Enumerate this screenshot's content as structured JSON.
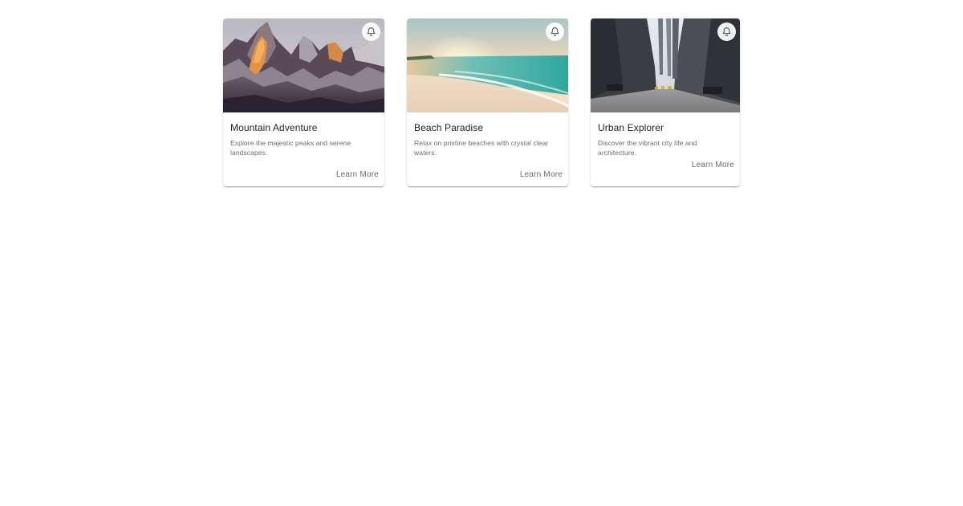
{
  "cards": [
    {
      "title": "Mountain Adventure",
      "description": "Explore the majestic peaks and serene landscapes.",
      "action_label": "Learn More",
      "notify_icon": "bell-icon",
      "image": "mountain-peaks"
    },
    {
      "title": "Beach Paradise",
      "description": "Relax on pristine beaches with crystal clear waters.",
      "action_label": "Learn More",
      "notify_icon": "bell-icon",
      "image": "beach-sunset"
    },
    {
      "title": "Urban Explorer",
      "description": "Discover the vibrant city life and architecture.",
      "action_label": "Learn More",
      "notify_icon": "bell-icon",
      "image": "city-street"
    }
  ]
}
